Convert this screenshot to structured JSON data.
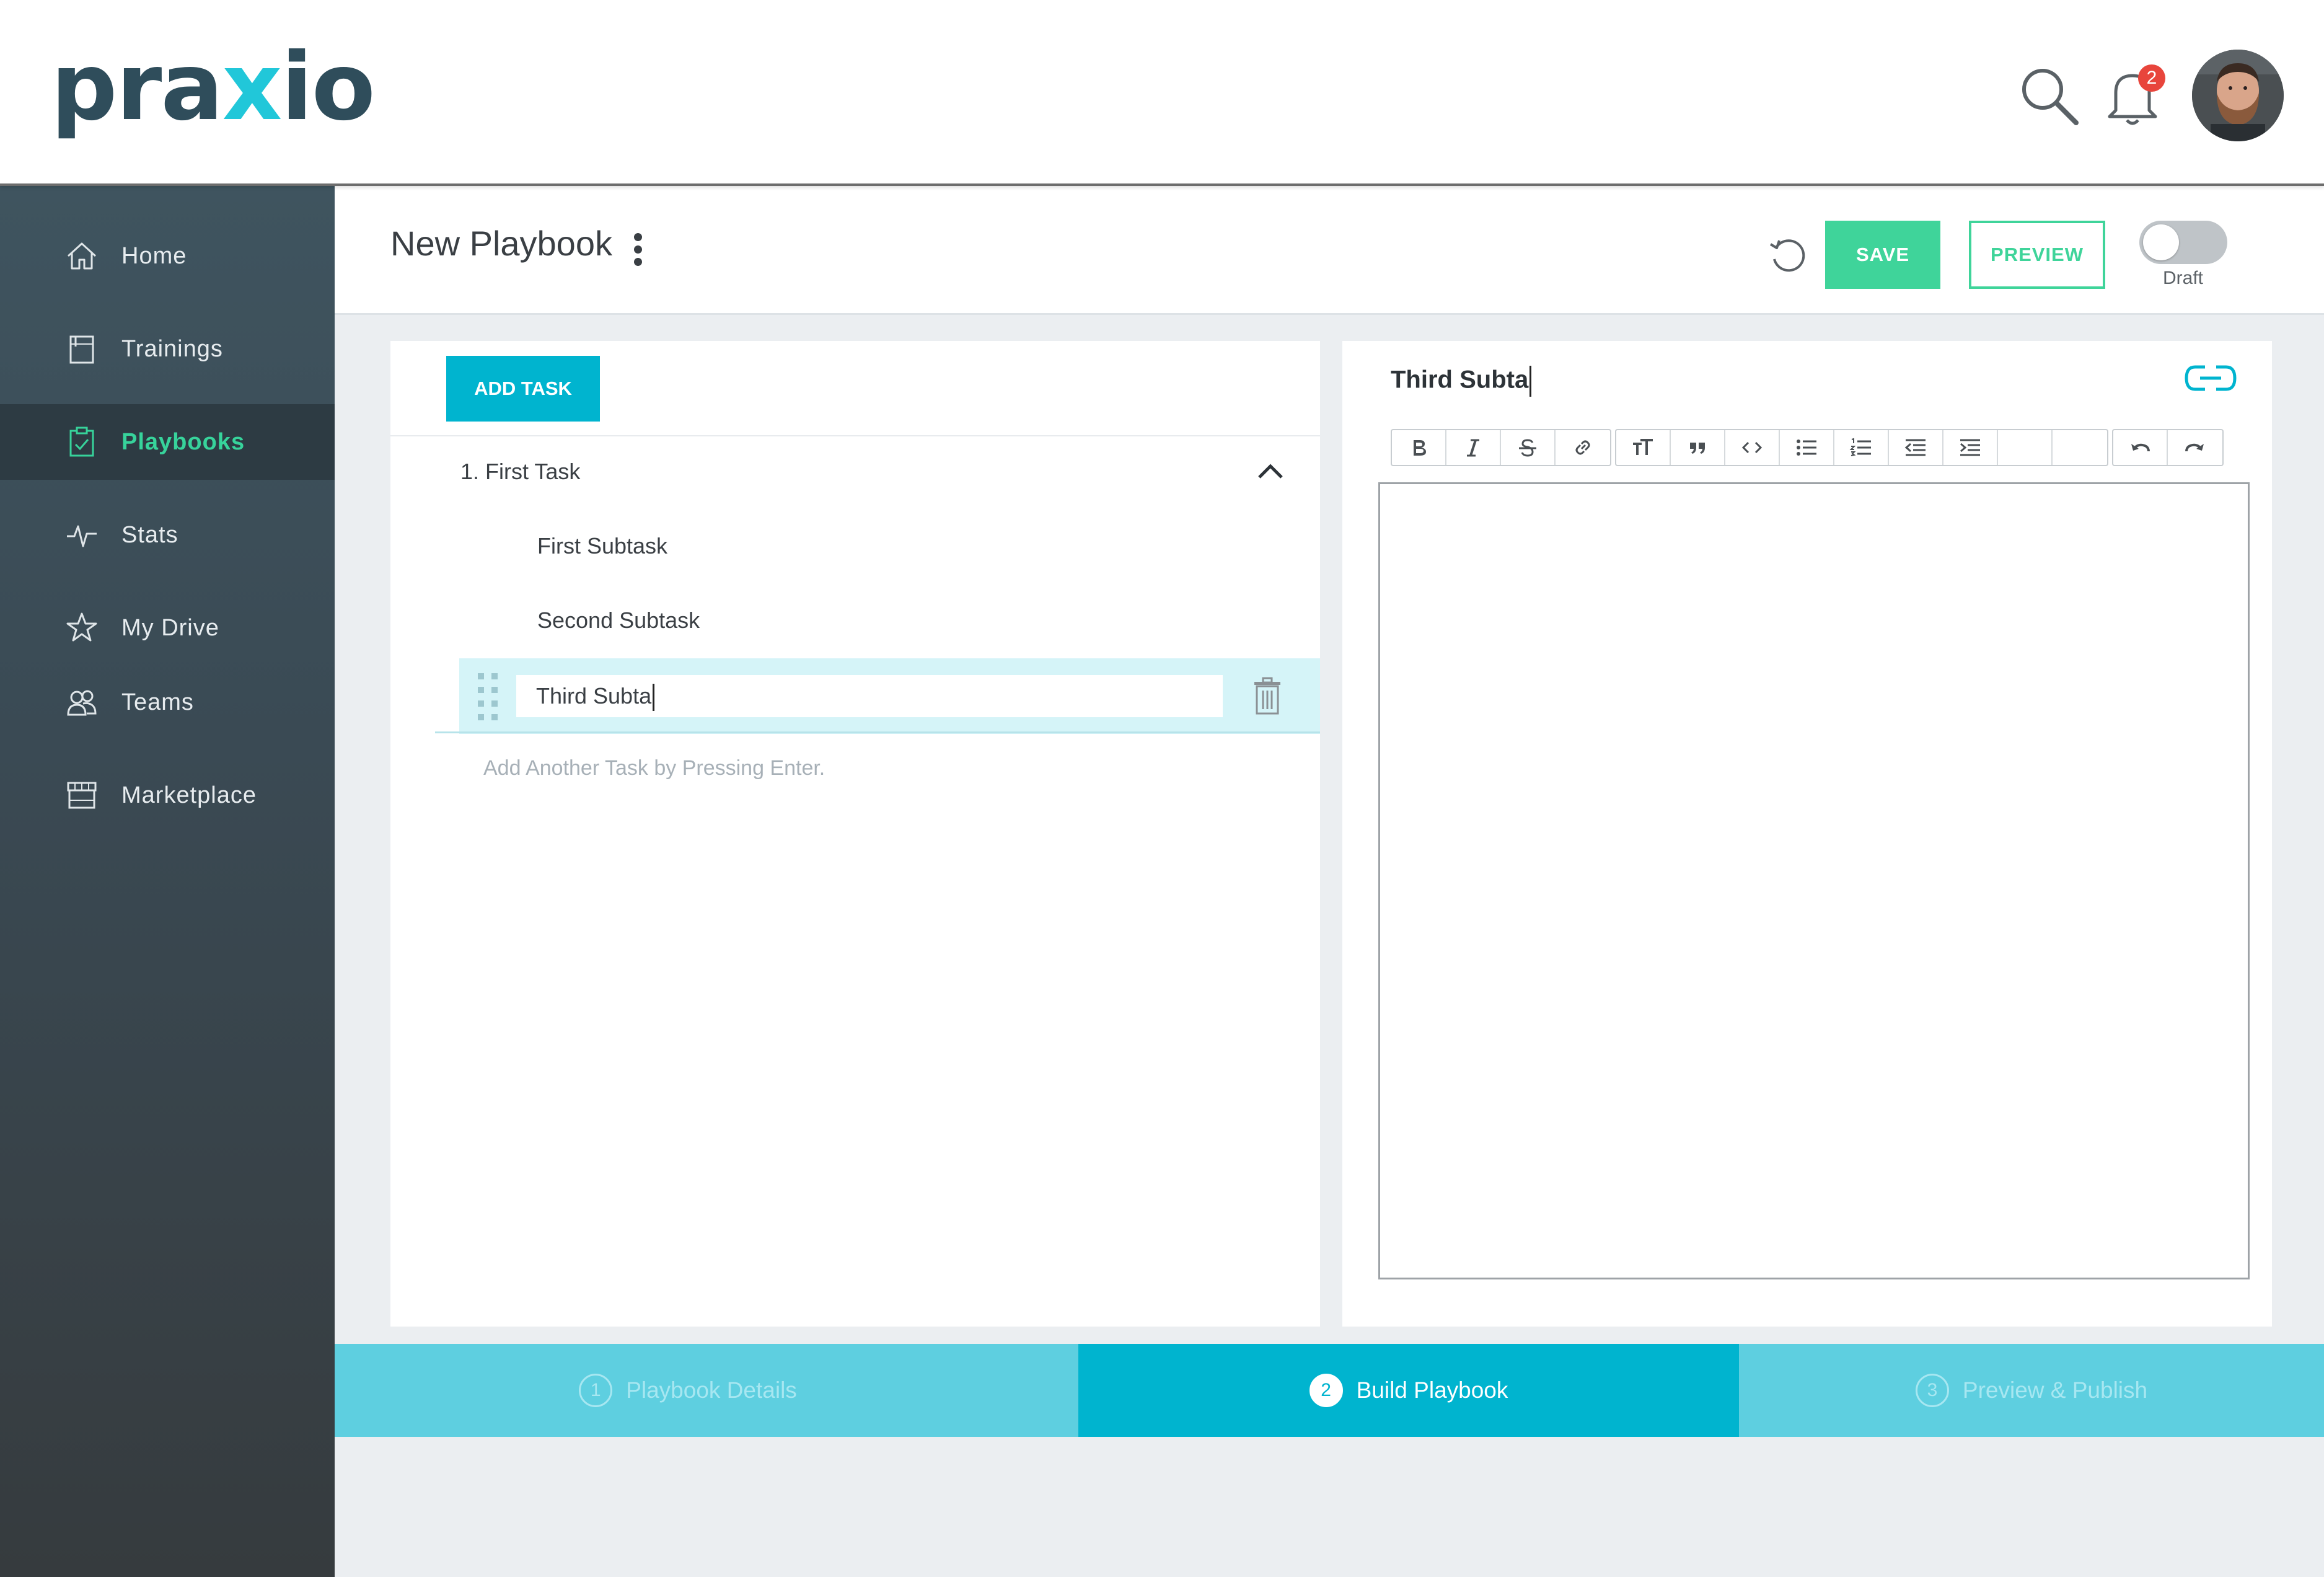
{
  "header": {
    "logo_main": "pra",
    "logo_accent": "x",
    "logo_end": "io",
    "notification_count": "2"
  },
  "sidebar": {
    "items": [
      {
        "label": "Home",
        "icon": "home-icon"
      },
      {
        "label": "Trainings",
        "icon": "book-icon"
      },
      {
        "label": "Playbooks",
        "icon": "clipboard-check-icon"
      },
      {
        "label": "Stats",
        "icon": "pulse-icon"
      },
      {
        "label": "My Drive",
        "icon": "star-icon"
      },
      {
        "label": "Teams",
        "icon": "users-icon"
      },
      {
        "label": "Marketplace",
        "icon": "store-icon"
      }
    ],
    "active_item": "Playbooks"
  },
  "titlebar": {
    "title": "New Playbook",
    "save_label": "SAVE",
    "preview_label": "PREVIEW",
    "status_label": "Draft"
  },
  "tasks": {
    "add_task_label": "ADD TASK",
    "task_title": "1. First Task",
    "subtasks": [
      "First Subtask",
      "Second Subtask"
    ],
    "editing_value": "Third Subta",
    "add_hint": "Add Another Task by Pressing Enter."
  },
  "editor": {
    "title": "Third Subta"
  },
  "stepper": {
    "steps": [
      {
        "num": "1",
        "label": "Playbook Details"
      },
      {
        "num": "2",
        "label": "Build Playbook"
      },
      {
        "num": "3",
        "label": "Preview & Publish"
      }
    ],
    "active_step": "2"
  },
  "colors": {
    "accent_green": "#3fd49a",
    "accent_cyan": "#00b4cf",
    "sidebar_bg": "#3f545f",
    "badge_red": "#e8453c"
  }
}
